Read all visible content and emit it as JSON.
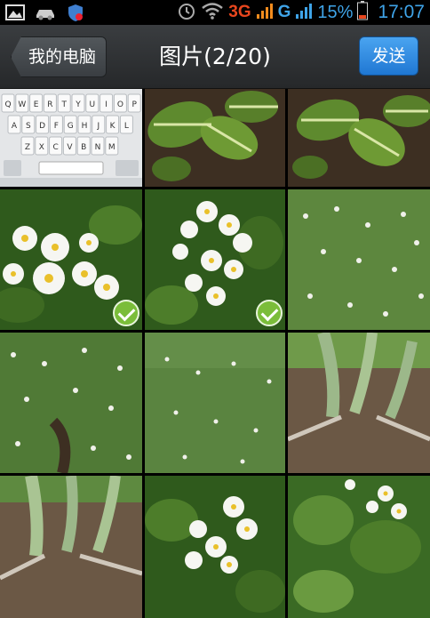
{
  "status_bar": {
    "network_3g": "3G",
    "network_g": "G",
    "battery_pct": "15%",
    "time": "17:07",
    "icons": [
      "gallery-icon",
      "car-icon",
      "shield-icon",
      "alarm-icon",
      "wifi-icon",
      "signal-icon",
      "battery-icon"
    ]
  },
  "header": {
    "back_label": "我的电脑",
    "title": "图片(2/20)",
    "send_label": "发送"
  },
  "colors": {
    "accent": "#2f8fe3",
    "check": "#7bbd3a",
    "status_blue": "#3fa4e8",
    "status_red": "#e8461e"
  },
  "keyboard_preview": {
    "row1": [
      "Q",
      "W",
      "E",
      "R",
      "T",
      "Y",
      "U",
      "I",
      "O",
      "P"
    ],
    "row2": [
      "A",
      "S",
      "D",
      "F",
      "G",
      "H",
      "J",
      "K",
      "L"
    ],
    "row3": [
      "Z",
      "X",
      "C",
      "V",
      "B",
      "N",
      "M"
    ]
  },
  "tiles": [
    {
      "kind": "keyboard",
      "selected": false
    },
    {
      "kind": "leaves",
      "selected": false
    },
    {
      "kind": "leaves",
      "selected": false
    },
    {
      "kind": "flowers-close",
      "selected": true
    },
    {
      "kind": "flowers-close",
      "selected": true
    },
    {
      "kind": "field",
      "selected": false
    },
    {
      "kind": "field",
      "selected": false
    },
    {
      "kind": "field",
      "selected": false
    },
    {
      "kind": "stems",
      "selected": false
    },
    {
      "kind": "stems",
      "selected": false
    },
    {
      "kind": "flowers-close",
      "selected": false
    },
    {
      "kind": "flowers-mixed",
      "selected": false
    }
  ]
}
